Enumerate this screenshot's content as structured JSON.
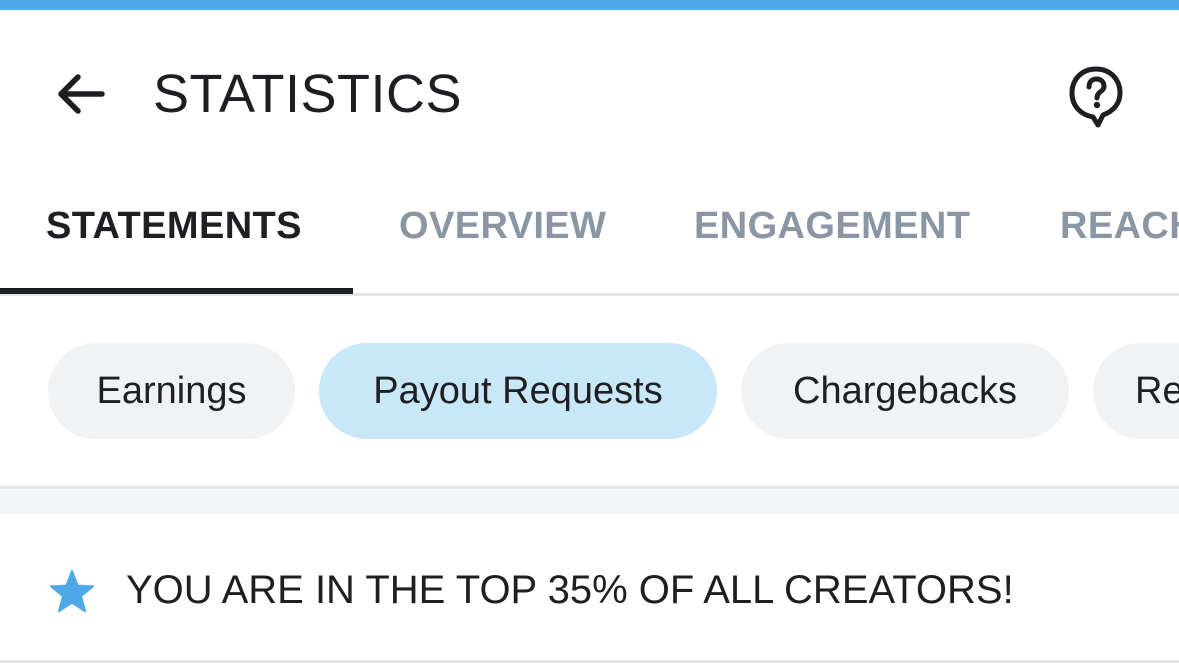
{
  "header": {
    "title": "STATISTICS",
    "back_icon": "arrow-left-icon",
    "help_icon": "question-bubble-icon"
  },
  "tabs": [
    {
      "label": "STATEMENTS",
      "active": true
    },
    {
      "label": "OVERVIEW",
      "active": false
    },
    {
      "label": "ENGAGEMENT",
      "active": false
    },
    {
      "label": "REACH",
      "active": false
    }
  ],
  "chips": [
    {
      "label": "Earnings",
      "active": false
    },
    {
      "label": "Payout Requests",
      "active": true
    },
    {
      "label": "Chargebacks",
      "active": false
    },
    {
      "label": "Re",
      "active": false
    }
  ],
  "banner": {
    "icon": "star-icon",
    "text": "YOU ARE IN THE TOP 35% OF ALL CREATORS!"
  },
  "colors": {
    "accent": "#4fa9e9",
    "active_chip": "#c8e7f7",
    "inactive_tab": "#8a96a3",
    "text": "#1d1f22"
  }
}
